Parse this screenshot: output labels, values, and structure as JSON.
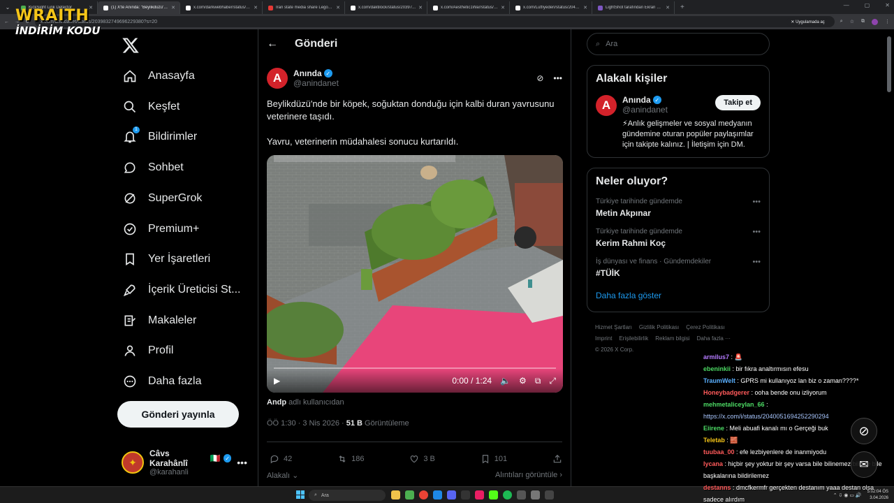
{
  "browser": {
    "tabs": [
      {
        "label": "KickSight Link Detector",
        "color": "#4caf50",
        "active": false
      },
      {
        "label": "(1) X'te Anında: \"Beylikdüzü'nde...",
        "color": "#ffffff",
        "active": true
      },
      {
        "label": "x.com/darkwebhaber/status/20...",
        "color": "#ffffff",
        "active": false
      },
      {
        "label": "Iran state media share Lego p...",
        "color": "#e53935",
        "active": false
      },
      {
        "label": "x.com/daktilock/status/20397...",
        "color": "#ffffff",
        "active": false
      },
      {
        "label": "x.com/Aesthetic1War/status/2...",
        "color": "#ffffff",
        "active": false
      },
      {
        "label": "x.com/Lutfiyeden/status/20400...",
        "color": "#ffffff",
        "active": false
      },
      {
        "label": "LightShot tarafından Ekran Gö...",
        "color": "#7e57c2",
        "active": false
      }
    ],
    "url": "x.com/anindanet/status/2039832749696229380?s=20",
    "app_badge": "Uygulamada aç"
  },
  "overlay": {
    "logo_top": "WRAITH",
    "logo_bottom": "İNDİRİM KODU"
  },
  "nav": {
    "items": [
      {
        "label": "Anasayfa",
        "icon": "home-icon"
      },
      {
        "label": "Keşfet",
        "icon": "search-icon"
      },
      {
        "label": "Bildirimler",
        "icon": "bell-icon",
        "badge": "1"
      },
      {
        "label": "Sohbet",
        "icon": "chat-icon"
      },
      {
        "label": "SuperGrok",
        "icon": "grok-icon"
      },
      {
        "label": "Premium+",
        "icon": "verified-icon"
      },
      {
        "label": "Yer İşaretleri",
        "icon": "bookmark-icon"
      },
      {
        "label": "İçerik Üreticisi St...",
        "icon": "rocket-icon"
      },
      {
        "label": "Makaleler",
        "icon": "article-icon"
      },
      {
        "label": "Profil",
        "icon": "person-icon"
      },
      {
        "label": "Daha fazla",
        "icon": "more-circle-icon"
      }
    ],
    "post_button": "Gönderi yayınla",
    "user": {
      "name": "Câvs Karahânlî",
      "flag": "🇮🇹",
      "handle": "@karahanli"
    }
  },
  "main": {
    "title": "Gönderi",
    "author": {
      "name": "Anında",
      "handle": "@anindanet",
      "avatar_letter": "A"
    },
    "text_p1": "Beylikdüzü'nde bir köpek, soğuktan donduğu için kalbi duran yavrusunu veterinere taşıdı.",
    "text_p2": "Yavru, veterinerin müdahalesi sonucu kurtarıldı.",
    "video": {
      "time": "0:00 / 1:24",
      "progress": 0.0
    },
    "tagged_user": "Andp",
    "tagged_suffix": "adlı kullanıcıdan",
    "meta_time": "ÖÖ 1:30 · 3 Nis 2026 · ",
    "views": "51 B",
    "views_label": " Görüntüleme",
    "stats": {
      "replies": "42",
      "reposts": "186",
      "likes": "3 B",
      "bookmarks": "101"
    },
    "relevant_label": "Alakalı",
    "quotes_label": "Alıntıları görüntüle"
  },
  "right": {
    "search_placeholder": "Ara",
    "relevant_title": "Alakalı kişiler",
    "relevant_person": {
      "name": "Anında",
      "handle": "@anindanet",
      "follow": "Takip et",
      "bio": "⚡Anlık gelişmeler ve sosyal medyanın gündemine oturan popüler paylaşımlar için takipte kalınız. | İletişim için DM."
    },
    "trends_title": "Neler oluyor?",
    "trends": [
      {
        "category": "Türkiye tarihinde gündemde",
        "name": "Metin Akpınar"
      },
      {
        "category": "Türkiye tarihinde gündemde",
        "name": "Kerim Rahmi Koç"
      },
      {
        "category": "İş dünyası ve finans · Gündemdekiler",
        "name": "#TÜİK"
      }
    ],
    "show_more": "Daha fazla göster",
    "footer_links": [
      "Hizmet Şartları",
      "Gizlilik Politikası",
      "Çerez Politikası",
      "Imprint",
      "Erişilebilirlik",
      "Reklam bilgisi",
      "Daha fazla ···"
    ],
    "copyright": "© 2026 X Corp."
  },
  "chat": [
    {
      "user": "armilus7",
      "color": "#b57bff",
      "msg": "🚨"
    },
    {
      "user": "ebeninkii",
      "color": "#4cd964",
      "msg": "bir fıkra analtırmısın efesu"
    },
    {
      "user": "TraumWelt",
      "color": "#5ab0ff",
      "msg": "GPRS mi kullanıyoz lan biz o zaman????*"
    },
    {
      "user": "Honeybadgerer",
      "color": "#ff5a5a",
      "msg": "ooha bende onu izliyorum"
    },
    {
      "user": "mehmetaliceylan_66",
      "color": "#4cd964",
      "msg": ""
    },
    {
      "user": "",
      "color": "#ffffff",
      "msg": "https://x.com/i/status/2040051694252290294"
    },
    {
      "user": "Eiirene",
      "color": "#4cd964",
      "msg": "Meli abuafi kanalı mı o Gerçeği buk"
    },
    {
      "user": "Teletab",
      "color": "#f5c518",
      "msg": "🧱"
    },
    {
      "user": "tuubaa_00",
      "color": "#ff5a5a",
      "msg": "efe lezbiyenlere de inanmiyodu"
    },
    {
      "user": "lycana",
      "color": "#ff5a5a",
      "msg": "hiçbir şey yoktur bir şey varsa bile bilinemez bilinse bile başkalarına bildirilemez"
    },
    {
      "user": "destanns",
      "color": "#ff5a5a",
      "msg": "dmcfkermfr gerçekten destanım yaaa destan olsa sadece alırdım"
    }
  ],
  "taskbar": {
    "search": "Ara",
    "time": "5:02:04 ÖS",
    "date": "3.04.2026"
  }
}
